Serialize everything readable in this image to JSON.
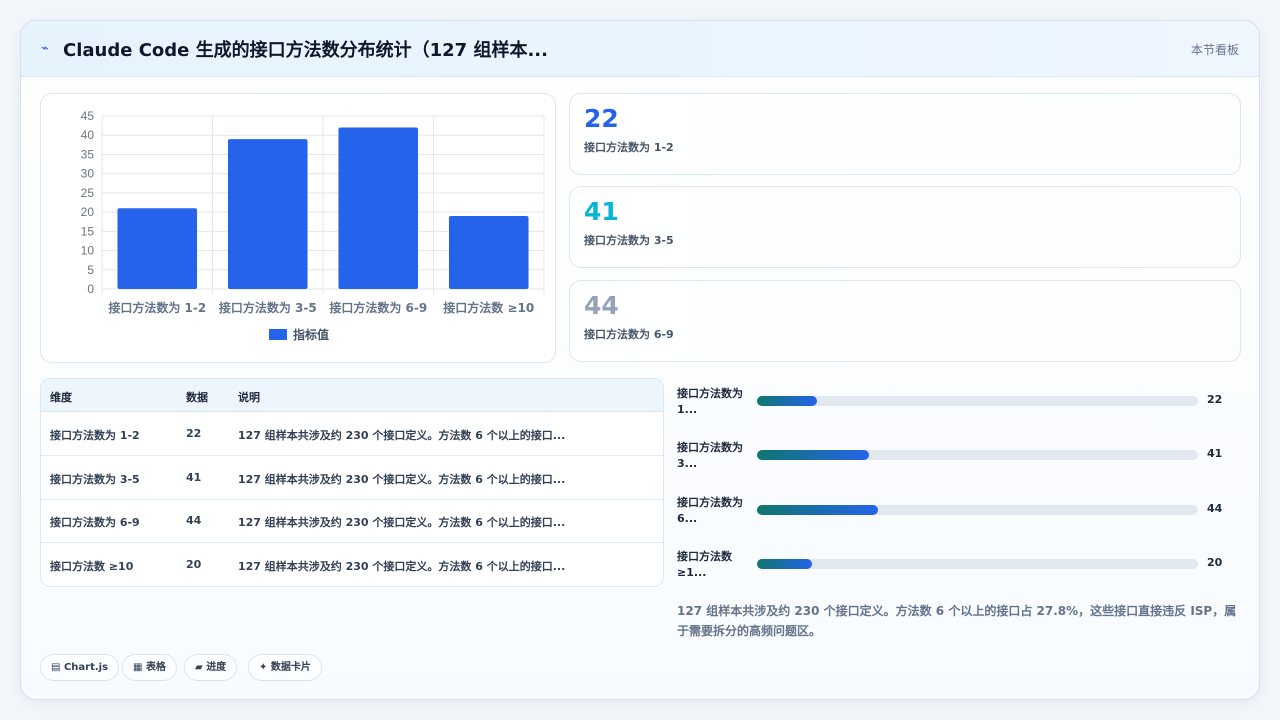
{
  "header": {
    "logo_icon": "lightning-icon",
    "title": "Claude Code 生成的接口方法数分布统计（127 组样本...",
    "right_label": "本节看板"
  },
  "chart_data": {
    "type": "bar",
    "categories": [
      "接口方法数为 1-2",
      "接口方法数为 3-5",
      "接口方法数为 6-9",
      "接口方法数 ≥10"
    ],
    "series": [
      {
        "name": "指标值",
        "values": [
          21,
          39,
          42,
          19
        ],
        "color": "#2563eb"
      }
    ],
    "yticks": [
      "0",
      "5",
      "10",
      "15",
      "20",
      "25",
      "30",
      "35",
      "40",
      "45"
    ],
    "ylim": [
      0,
      45
    ],
    "grid": true,
    "legend": "bottom"
  },
  "stats": [
    {
      "value": "22",
      "label": "接口方法数为 1-2",
      "color": "#2563eb"
    },
    {
      "value": "41",
      "label": "接口方法数为 3-5",
      "color": "#06b6d4"
    },
    {
      "value": "44",
      "label": "接口方法数为 6-9",
      "color": "#94a3b8"
    }
  ],
  "table": {
    "headers": [
      "维度",
      "数据",
      "说明"
    ],
    "rows": [
      [
        "接口方法数为 1-2",
        "22",
        "127 组样本共涉及约 230 个接口定义。方法数 6 个以上的接口..."
      ],
      [
        "接口方法数为 3-5",
        "41",
        "127 组样本共涉及约 230 个接口定义。方法数 6 个以上的接口..."
      ],
      [
        "接口方法数为 6-9",
        "44",
        "127 组样本共涉及约 230 个接口定义。方法数 6 个以上的接口..."
      ],
      [
        "接口方法数 ≥10",
        "20",
        "127 组样本共涉及约 230 个接口定义。方法数 6 个以上的接口..."
      ]
    ]
  },
  "progress": [
    {
      "label1": "接口方法数为",
      "label2": "1...",
      "value": "22",
      "fraction": 0.136
    },
    {
      "label1": "接口方法数为",
      "label2": "3...",
      "value": "41",
      "fraction": 0.254
    },
    {
      "label1": "接口方法数为",
      "label2": "6...",
      "value": "44",
      "fraction": 0.274
    },
    {
      "label1": "接口方法数",
      "label2": "≥1...",
      "value": "20",
      "fraction": 0.124
    }
  ],
  "note": "127 组样本共涉及约 230 个接口定义。方法数 6 个以上的接口占 27.8%，这些接口直接违反 ISP，属于需要拆分的高频问题区。",
  "chips": [
    {
      "icon": "chart-icon",
      "glyph": "▤",
      "label": "Chart.js"
    },
    {
      "icon": "table-icon",
      "glyph": "▦",
      "label": "表格"
    },
    {
      "icon": "progress-icon",
      "glyph": "▰",
      "label": "进度"
    },
    {
      "icon": "sparkle-icon",
      "glyph": "✦",
      "label": "数据卡片"
    }
  ]
}
